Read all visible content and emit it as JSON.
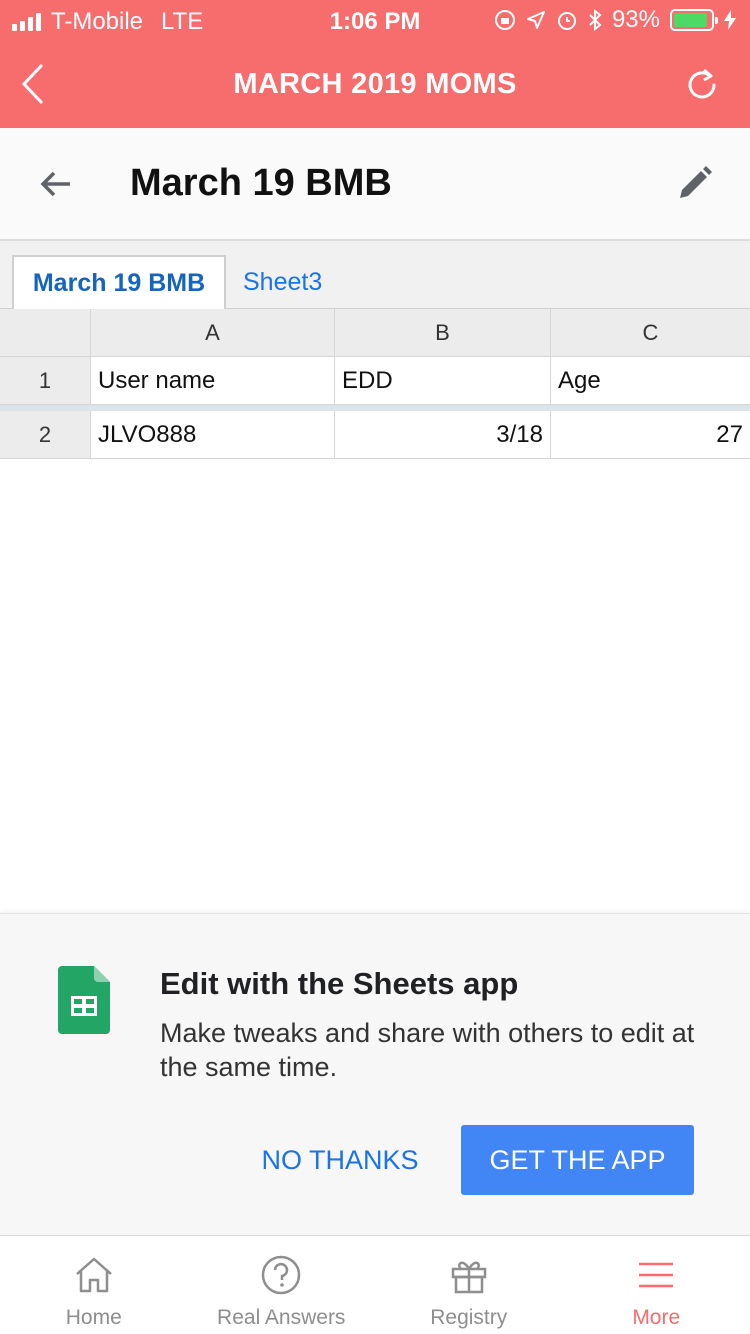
{
  "status_bar": {
    "carrier": "T-Mobile",
    "network": "LTE",
    "time": "1:06 PM",
    "battery": "93%",
    "battery_level": 0.93
  },
  "app_header": {
    "title": "MARCH 2019 MOMS",
    "back_icon": "chevron-left-icon",
    "refresh_icon": "refresh-icon",
    "color": "#f76c6c"
  },
  "sheet": {
    "title": "March 19 BMB",
    "tabs": [
      {
        "label": "March 19 BMB",
        "active": true
      },
      {
        "label": "Sheet3",
        "active": false
      }
    ],
    "columns": [
      "A",
      "B",
      "C"
    ],
    "rows": [
      {
        "num": "1",
        "cells": [
          "User name",
          "EDD",
          "Age"
        ]
      },
      {
        "num": "2",
        "cells": [
          "JLVO888",
          "3/18",
          "27"
        ]
      }
    ]
  },
  "banner": {
    "title": "Edit with the Sheets app",
    "text": "Make tweaks and share with others to edit at the same time.",
    "dismiss_label": "NO THANKS",
    "cta_label": "GET THE APP",
    "cta_color": "#4285f4"
  },
  "bottom_nav": [
    {
      "label": "Home",
      "icon": "home-icon",
      "active": false
    },
    {
      "label": "Real Answers",
      "icon": "question-icon",
      "active": false
    },
    {
      "label": "Registry",
      "icon": "gift-icon",
      "active": false
    },
    {
      "label": "More",
      "icon": "menu-icon",
      "active": true
    }
  ]
}
